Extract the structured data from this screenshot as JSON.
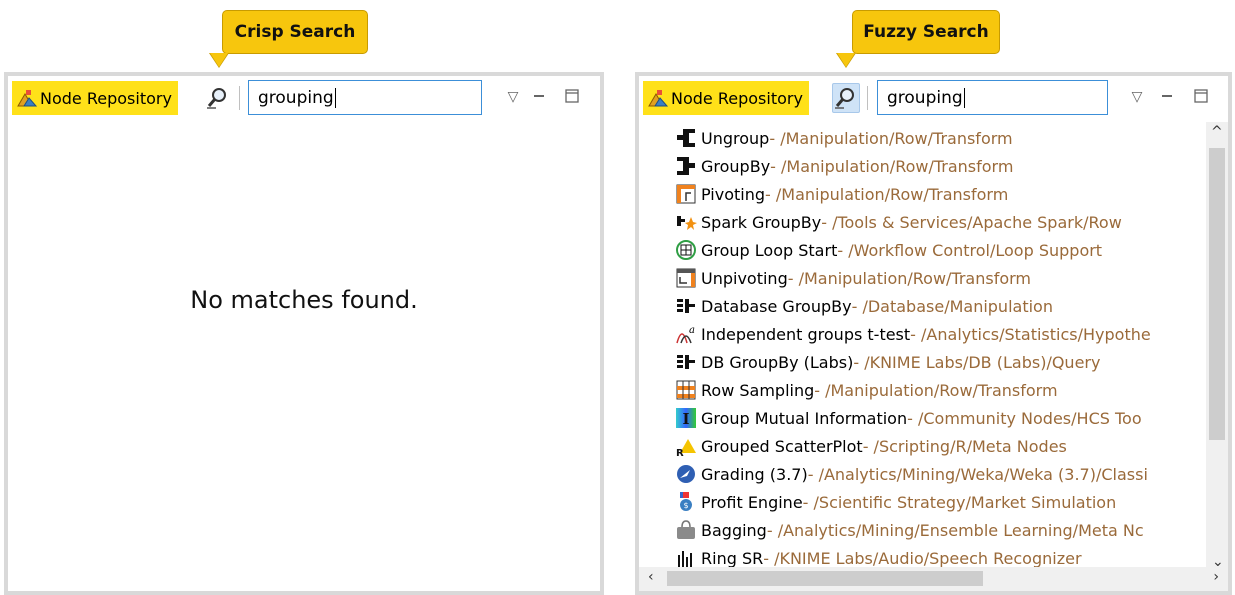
{
  "callouts": {
    "left": "Crisp Search",
    "right": "Fuzzy Search"
  },
  "colors": {
    "callout": "#f7c60d",
    "tab_highlight": "#ffe119",
    "path_text": "#9a6a3a",
    "search_border": "#3c8fd8"
  },
  "left_panel": {
    "tab_label": "Node Repository",
    "search_value": "grouping",
    "search_mode": "crisp",
    "empty_message": "No matches found."
  },
  "right_panel": {
    "tab_label": "Node Repository",
    "search_value": "grouping",
    "search_mode": "fuzzy",
    "results": [
      {
        "name": "Ungroup",
        "path": " - /Manipulation/Row/Transform",
        "icon": "ungroup-icon"
      },
      {
        "name": "GroupBy",
        "path": " - /Manipulation/Row/Transform",
        "icon": "groupby-icon"
      },
      {
        "name": "Pivoting",
        "path": " - /Manipulation/Row/Transform",
        "icon": "pivoting-icon"
      },
      {
        "name": "Spark GroupBy",
        "path": " - /Tools & Services/Apache Spark/Row",
        "icon": "spark-groupby-icon"
      },
      {
        "name": "Group Loop Start",
        "path": " - /Workflow Control/Loop Support",
        "icon": "group-loop-start-icon"
      },
      {
        "name": "Unpivoting",
        "path": " - /Manipulation/Row/Transform",
        "icon": "unpivoting-icon"
      },
      {
        "name": "Database GroupBy",
        "path": " - /Database/Manipulation",
        "icon": "database-groupby-icon"
      },
      {
        "name": "Independent groups t-test",
        "path": " - /Analytics/Statistics/Hypothe",
        "icon": "t-test-icon"
      },
      {
        "name": "DB GroupBy (Labs)",
        "path": " - /KNIME Labs/DB (Labs)/Query",
        "icon": "db-groupby-icon"
      },
      {
        "name": "Row Sampling",
        "path": " - /Manipulation/Row/Transform",
        "icon": "row-sampling-icon"
      },
      {
        "name": "Group Mutual Information",
        "path": " - /Community Nodes/HCS Too",
        "icon": "mutual-information-icon"
      },
      {
        "name": "Grouped ScatterPlot",
        "path": " - /Scripting/R/Meta Nodes",
        "icon": "r-scatterplot-icon"
      },
      {
        "name": "Grading (3.7)",
        "path": " - /Analytics/Mining/Weka/Weka (3.7)/Classi",
        "icon": "weka-icon"
      },
      {
        "name": "Profit Engine",
        "path": " - /Scientific Strategy/Market Simulation",
        "icon": "profit-engine-icon"
      },
      {
        "name": "Bagging",
        "path": " - /Analytics/Mining/Ensemble Learning/Meta Nc",
        "icon": "bagging-icon"
      },
      {
        "name": "Ring SR",
        "path": " - /KNIME Labs/Audio/Speech Recognizer",
        "icon": "audio-icon"
      }
    ]
  }
}
